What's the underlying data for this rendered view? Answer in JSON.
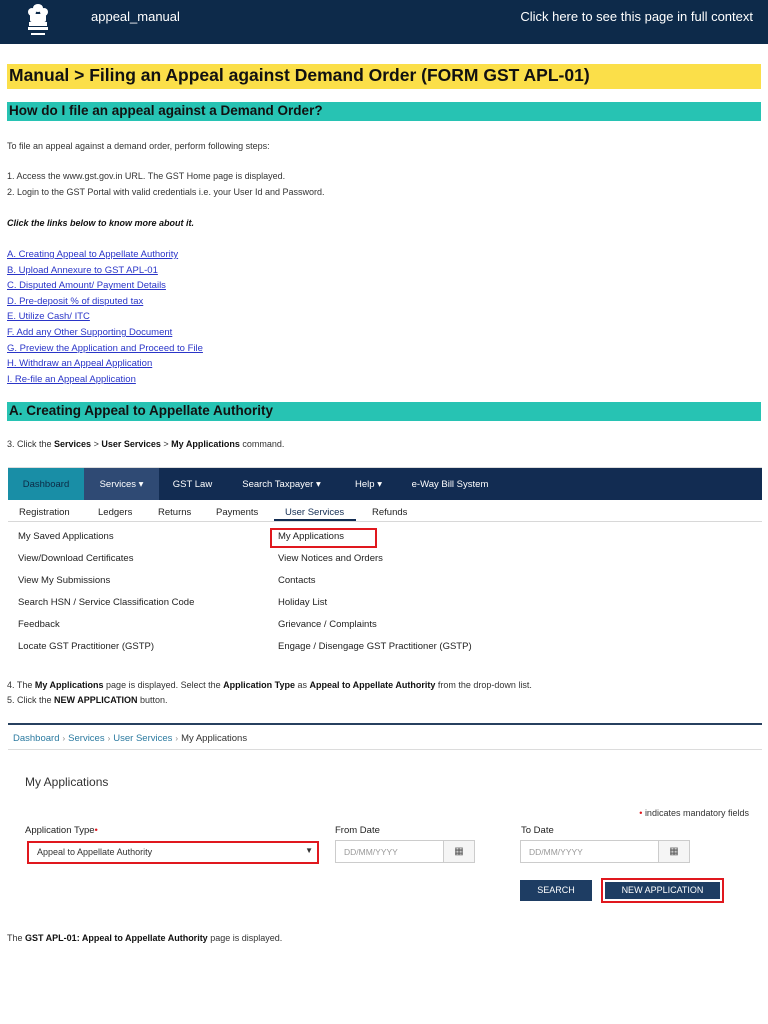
{
  "header": {
    "app_name": "appeal_manual",
    "full_context_link": "Click here to see this page in full context"
  },
  "title": "Manual > Filing an Appeal against Demand Order (FORM GST APL-01)",
  "section1": {
    "heading": "How do I file an appeal against a Demand Order?",
    "intro": "To file an appeal against a demand order, perform following steps:",
    "step1": "1.  Access the www.gst.gov.in URL. The GST Home page is displayed.",
    "step2": "2. Login to the GST Portal with valid credentials i.e. your User Id and Password.",
    "links_note": "Click the links below to know more about it.",
    "links": [
      "A. Creating Appeal to Appellate Authority",
      "B. Upload Annexure to GST APL-01",
      "C. Disputed Amount/ Payment Details",
      "D. Pre-deposit % of disputed tax",
      "E. Utilize Cash/ ITC",
      "F. Add any Other Supporting Document",
      "G. Preview the Application and Proceed to File",
      "H. Withdraw an Appeal Application",
      "I. Re-file an Appeal Application"
    ]
  },
  "section2": {
    "heading": "A. Creating Appeal to Appellate Authority",
    "step3": {
      "prefix": "3. Click the ",
      "services": "Services",
      "gt1": " > ",
      "user_services": "User Services",
      "gt2": " > ",
      "my_applications": "My Applications",
      "suffix": " command."
    },
    "step4": {
      "p1": "4. The ",
      "b1": "My Applications",
      "p2": " page is displayed. Select the ",
      "b2": "Application Type",
      "p3": " as ",
      "b3": "Appeal to Appellate Authority",
      "p4": " from the drop-down list."
    },
    "step5": {
      "p1": "5. Click the ",
      "b1": "NEW APPLICATION",
      "p2": " button."
    },
    "closing": {
      "p1": "The ",
      "b1": "GST APL-01: Appeal to Appellate Authority",
      "p2": " page is displayed."
    }
  },
  "menu_screenshot": {
    "nav": [
      "Dashboard",
      "Services ▾",
      "GST Law",
      "Search Taxpayer ▾",
      "Help ▾",
      "e-Way Bill System"
    ],
    "subnav": [
      "Registration",
      "Ledgers",
      "Returns",
      "Payments",
      "User Services",
      "Refunds"
    ],
    "left_items": [
      "My Saved Applications",
      "View/Download Certificates",
      "View My Submissions",
      "Search HSN / Service Classification Code",
      "Feedback",
      "Locate GST Practitioner (GSTP)"
    ],
    "right_items": [
      "My Applications",
      "View Notices and Orders",
      "Contacts",
      "Holiday List",
      "Grievance / Complaints",
      "Engage / Disengage GST Practitioner (GSTP)"
    ]
  },
  "form_screenshot": {
    "breadcrumb": [
      "Dashboard",
      "Services",
      "User Services",
      "My Applications"
    ],
    "title": "My Applications",
    "mandatory_note": "indicates mandatory fields",
    "application_type_label": "Application Type",
    "application_type_value": "Appeal to Appellate Authority",
    "from_date_label": "From Date",
    "to_date_label": "To Date",
    "date_placeholder": "DD/MM/YYYY",
    "search_button": "SEARCH",
    "new_application_button": "NEW APPLICATION"
  }
}
